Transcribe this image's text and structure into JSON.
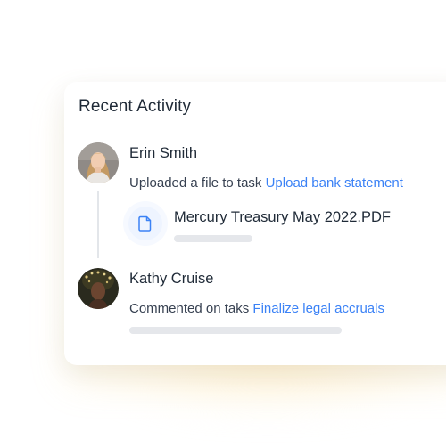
{
  "card": {
    "title": "Recent Activity"
  },
  "activities": [
    {
      "name": "Erin Smith",
      "avatar": "avatar-erin-smith",
      "action_text": "Uploaded a file to task ",
      "link_text": "Upload bank statement",
      "attachment": {
        "icon": "document-icon",
        "file_name": "Mercury Treasury May 2022.PDF"
      }
    },
    {
      "name": "Kathy Cruise",
      "avatar": "avatar-kathy-cruise",
      "action_text": "Commented on taks ",
      "link_text": "Finalize legal accruals"
    }
  ],
  "colors": {
    "link": "#3b82f6",
    "heading": "#1f2a37",
    "body_text": "#374151",
    "placeholder_bar": "#e5e7eb",
    "icon_bg": "#eef4ff",
    "accent_glow": "#fdecc4"
  }
}
